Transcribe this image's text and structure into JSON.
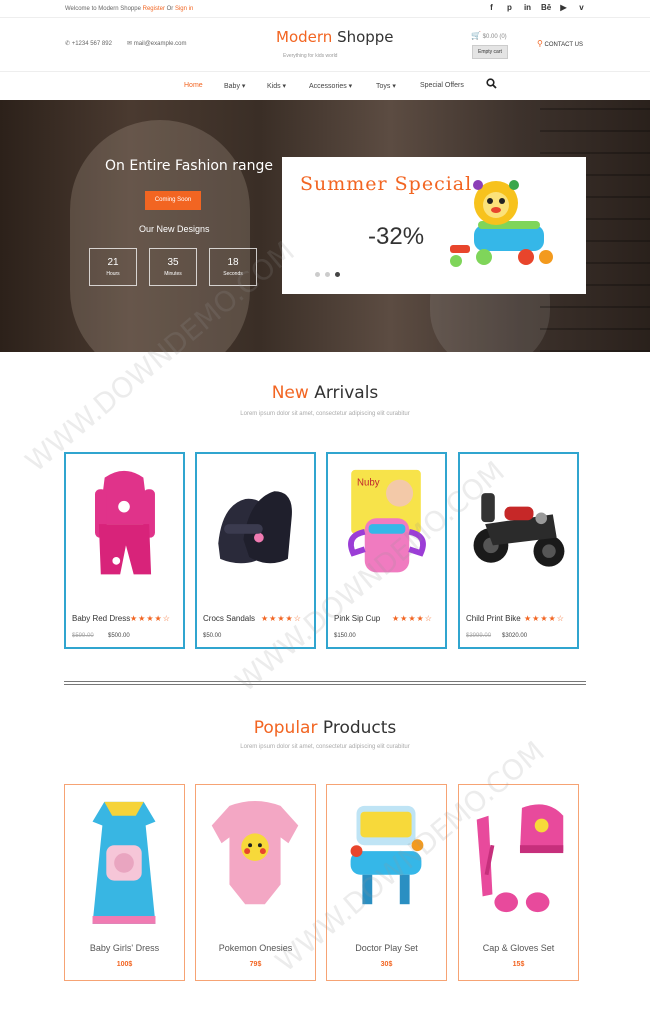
{
  "topbar": {
    "welcome": "Welcome to Modern Shoppe",
    "register": "Register",
    "or": "Or",
    "signin": "Sign in",
    "social": [
      {
        "icon": "facebook-icon",
        "glyph": "f"
      },
      {
        "icon": "pinterest-icon",
        "glyph": "p"
      },
      {
        "icon": "linkedin-icon",
        "glyph": "in"
      },
      {
        "icon": "behance-icon",
        "glyph": "Bē"
      },
      {
        "icon": "youtube-icon",
        "glyph": "▶"
      },
      {
        "icon": "vimeo-icon",
        "glyph": "v"
      }
    ]
  },
  "header": {
    "phone": "+1234 567 892",
    "email": "mail@example.com",
    "logo_1": "Modern",
    "logo_2": "Shoppe",
    "tagline": "Everything for kids world",
    "cart": "$0.00 (0)",
    "empty_cart": "Empty cart",
    "location": "CONTACT US"
  },
  "nav": {
    "items": [
      "Home",
      "Baby ▾",
      "Kids ▾",
      "Accessories ▾",
      "Toys ▾",
      "Special Offers"
    ]
  },
  "hero": {
    "headline": "On Entire Fashion range",
    "coming_soon": "Coming Soon",
    "designs": "Our New Designs",
    "countdown": [
      {
        "num": "21",
        "label": "Hours"
      },
      {
        "num": "35",
        "label": "Minutes"
      },
      {
        "num": "18",
        "label": "Seconds"
      }
    ],
    "promo_title": "Summer Special",
    "promo_pct": "-32%",
    "active_slide": 3
  },
  "arrivals": {
    "title_1": "New",
    "title_2": "Arrivals",
    "subtitle": "Lorem ipsum dolor sit amet, consectetur adipiscing elit curabitur",
    "products": [
      {
        "name": "Baby Red Dress",
        "stars": "★★★★☆",
        "old": "$599.00",
        "price": "$500.00"
      },
      {
        "name": "Crocs Sandals",
        "stars": "★★★★☆",
        "old": "",
        "price": "$50.00"
      },
      {
        "name": "Pink Sip Cup",
        "stars": "★★★★☆",
        "old": "",
        "price": "$150.00"
      },
      {
        "name": "Child Print Bike",
        "stars": "★★★★☆",
        "old": "$3999.00",
        "price": "$3020.00"
      }
    ]
  },
  "popular": {
    "title_1": "Popular",
    "title_2": "Products",
    "subtitle": "Lorem ipsum dolor sit amet, consectetur adipiscing elit curabitur",
    "products": [
      {
        "name": "Baby Girls' Dress",
        "price": "100$"
      },
      {
        "name": "Pokemon Onesies",
        "price": "79$"
      },
      {
        "name": "Doctor Play Set",
        "price": "30$"
      },
      {
        "name": "Cap & Gloves Set",
        "price": "15$"
      }
    ]
  },
  "watermark": "WWW.DOWNDEMO.COM",
  "colors": {
    "accent": "#f26522",
    "card_blue": "#30a5cf",
    "card_orange": "#f6a374"
  }
}
